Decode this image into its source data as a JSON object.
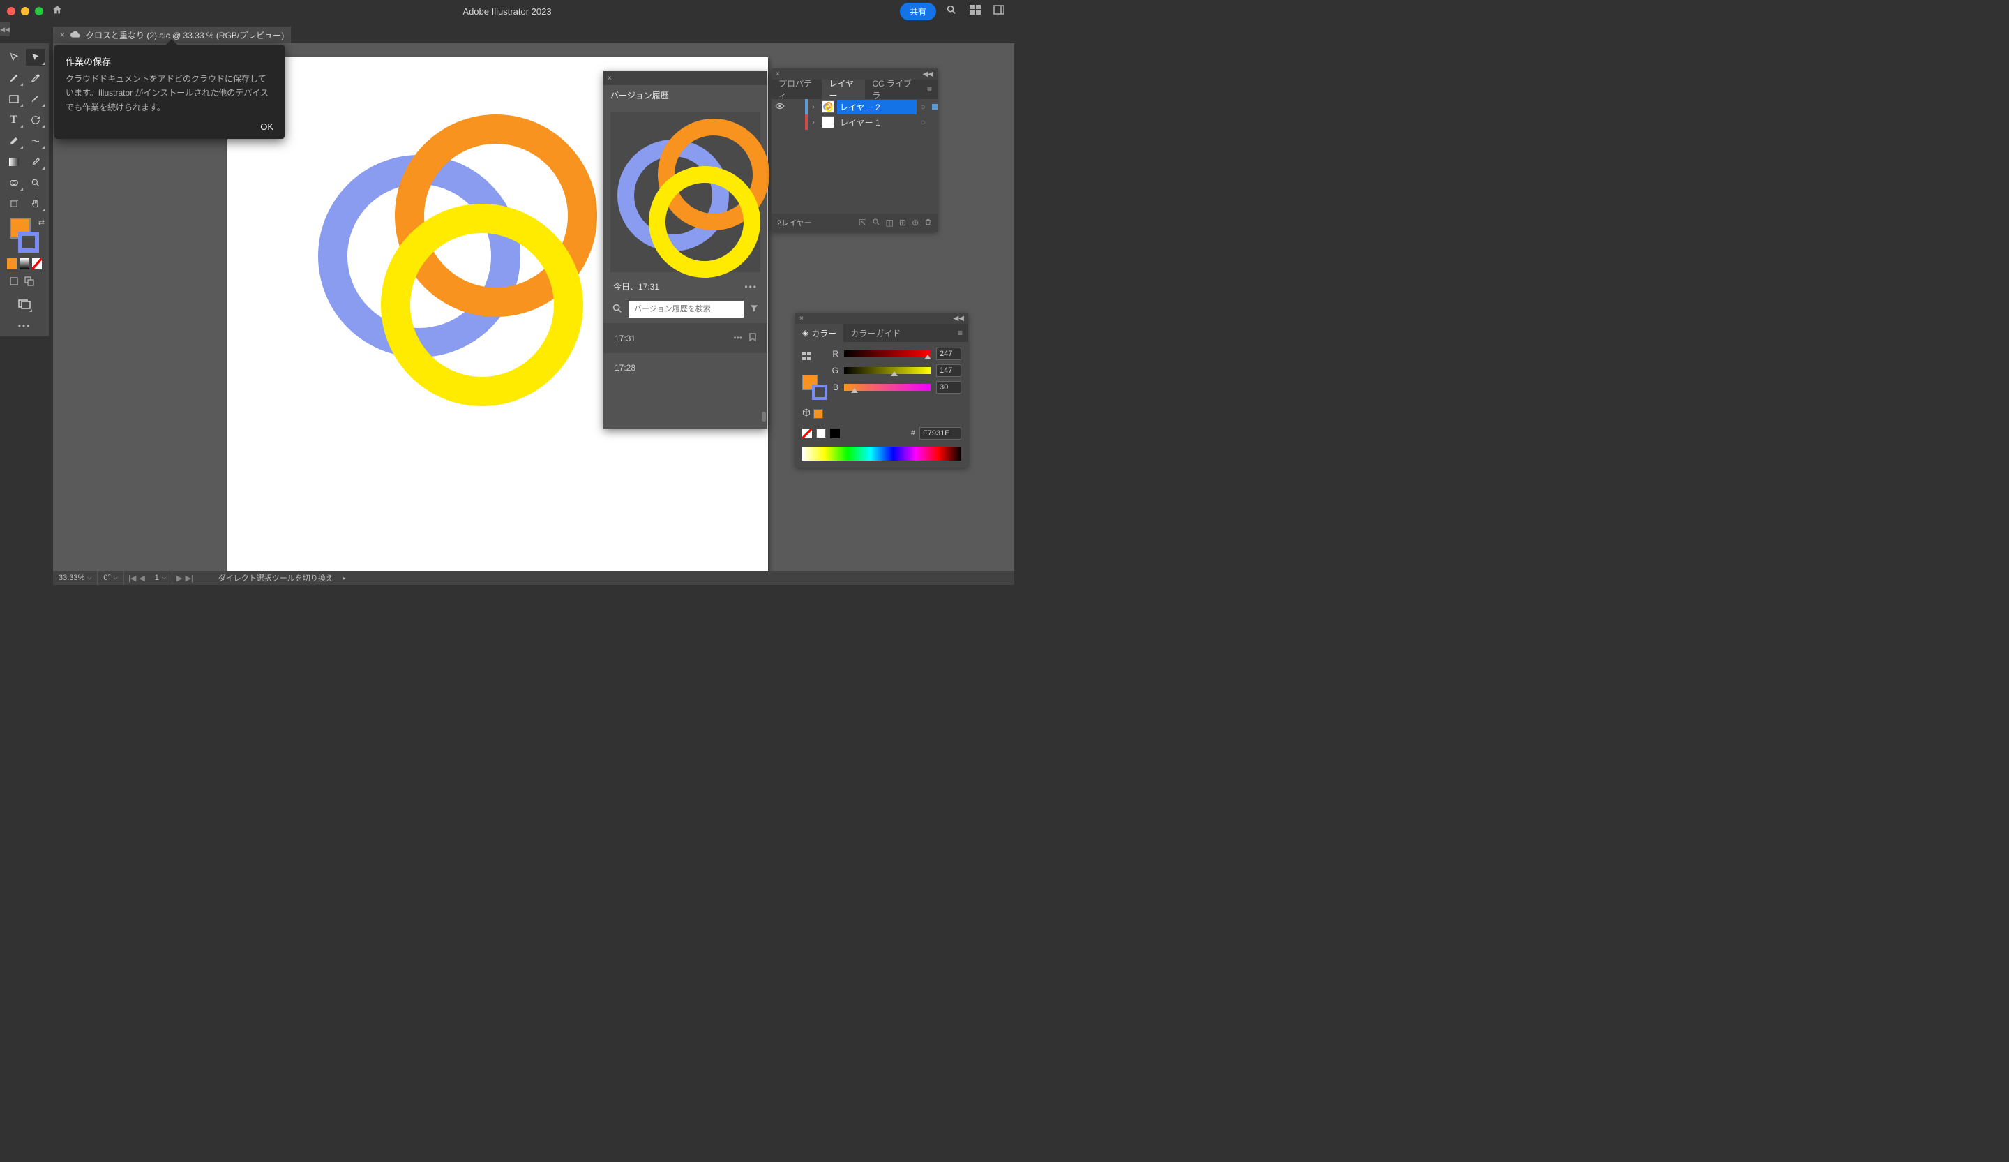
{
  "app": {
    "title": "Adobe Illustrator 2023",
    "share": "共有"
  },
  "document": {
    "filename": "クロスと重なり (2).aic @ 33.33 % (RGB/プレビュー)"
  },
  "tooltip": {
    "title": "作業の保存",
    "body": "クラウドドキュメントをアドビのクラウドに保存しています。Illustrator がインストールされた他のデバイスでも作業を続けられます。",
    "ok": "OK"
  },
  "version_history": {
    "tab": "バージョン履歴",
    "date": "今日、17:31",
    "search_placeholder": "バージョン履歴を検索",
    "items": [
      {
        "time": "17:31",
        "active": true
      },
      {
        "time": "17:28",
        "active": false
      }
    ]
  },
  "layers_panel": {
    "tabs": {
      "properties": "プロパティ",
      "layers": "レイヤー",
      "cc": "CC ライブラ"
    },
    "layers": [
      {
        "name": "レイヤー 2",
        "visible": true,
        "selected": true,
        "color": "blue"
      },
      {
        "name": "レイヤー 1",
        "visible": false,
        "selected": false,
        "color": "red"
      }
    ],
    "footer": "2レイヤー"
  },
  "color_panel": {
    "tabs": {
      "color": "カラー",
      "guide": "カラーガイド"
    },
    "r": {
      "label": "R",
      "value": "247"
    },
    "g": {
      "label": "G",
      "value": "147"
    },
    "b": {
      "label": "B",
      "value": "30"
    },
    "hex_label": "#",
    "hex": "F7931E"
  },
  "statusbar": {
    "zoom": "33.33%",
    "rotation": "0°",
    "artboard": "1",
    "hint": "ダイレクト選択ツールを切り換え"
  }
}
